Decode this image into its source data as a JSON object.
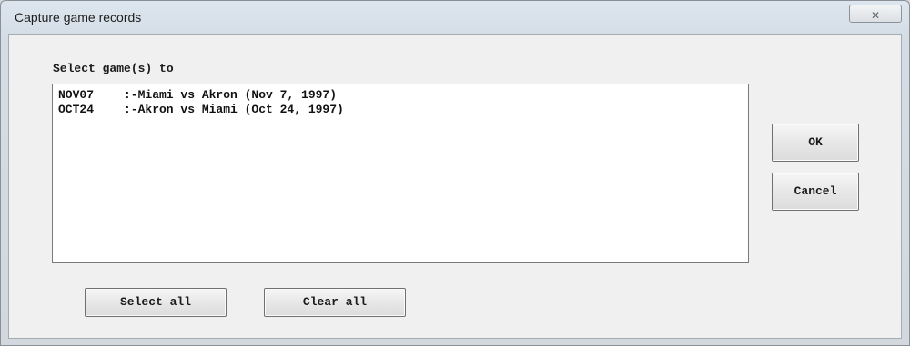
{
  "window": {
    "title": "Capture game records",
    "close_glyph": "✕"
  },
  "dialog": {
    "prompt": "Select game(s) to",
    "games": [
      {
        "code": "NOV07",
        "description": ":-Miami vs Akron (Nov 7, 1997)"
      },
      {
        "code": "OCT24",
        "description": ":-Akron vs Miami (Oct 24, 1997)"
      }
    ],
    "ok_label": "OK",
    "cancel_label": "Cancel",
    "select_all_label": "Select all",
    "clear_all_label": "Clear all"
  },
  "colors": {
    "titlebar": "#dde6ef",
    "client_bg": "#f0f0f0",
    "listbox_bg": "#ffffff"
  }
}
